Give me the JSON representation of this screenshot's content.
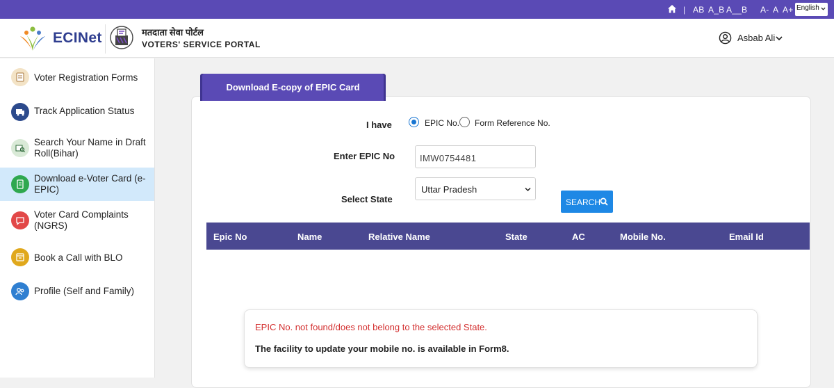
{
  "topbar": {
    "separator": "|",
    "font_size_items": [
      "AB",
      "A_B",
      "A__B"
    ],
    "zoom_items": [
      "A-",
      "A",
      "A+"
    ],
    "language": "English",
    "bg_color": "#5a4ab5"
  },
  "header": {
    "brand": "ECINet",
    "portal_hindi": "मतदाता सेवा पोर्टल",
    "portal_english": "VOTERS' SERVICE PORTAL",
    "user_name": "Asbab Ali"
  },
  "sidebar": {
    "items": [
      {
        "label": "Voter Registration Forms",
        "icon": "form-icon",
        "color": "#f3e3c6"
      },
      {
        "label": "Track Application Status",
        "icon": "track-icon",
        "color": "#2c4a8c"
      },
      {
        "label": "Search Your Name in Draft Roll(Bihar)",
        "icon": "roll-search-icon",
        "color": "#d9ead7"
      },
      {
        "label": "Download e-Voter Card (e-EPIC)",
        "icon": "download-card-icon",
        "color": "#2fa84f"
      },
      {
        "label": "Voter Card Complaints (NGRS)",
        "icon": "complaint-icon",
        "color": "#e24848"
      },
      {
        "label": "Book a Call with BLO",
        "icon": "call-blo-icon",
        "color": "#e0a81c"
      },
      {
        "label": "Profile (Self and Family)",
        "icon": "profile-icon",
        "color": "#2f7fd1"
      }
    ],
    "active_index": 3
  },
  "main": {
    "tab_title": "Download E-copy of EPIC Card",
    "i_have_label": "I have",
    "radio_options": [
      "EPIC No.",
      "Form Reference No."
    ],
    "selected_option": "EPIC No.",
    "epic_label": "Enter EPIC No",
    "epic_value": "IMW0754481",
    "state_label": "Select State",
    "state_value": "Uttar Pradesh",
    "search_label": "SEARCH",
    "table_headers": [
      "Epic No",
      "Name",
      "Relative Name",
      "State",
      "AC",
      "Mobile No.",
      "Email Id"
    ],
    "error_message": "EPIC No. not found/does not belong to the selected State.",
    "info_message": "The facility to update your mobile no. is available in Form8."
  }
}
